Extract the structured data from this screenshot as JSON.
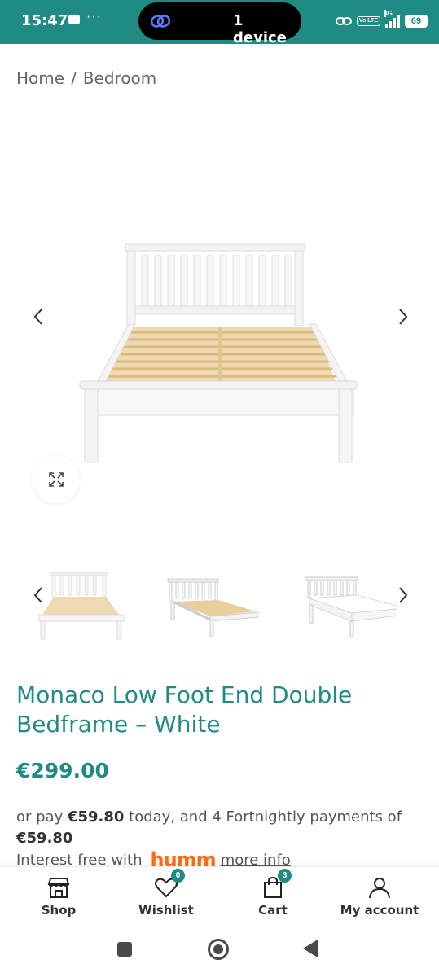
{
  "status_bar": {
    "time": "15:47",
    "dots": "···",
    "pill_label": "1 device",
    "network": "4G",
    "volte": "Vo LTE",
    "battery": "69"
  },
  "breadcrumb": {
    "home": "Home",
    "separator": "/",
    "current": "Bedroom"
  },
  "gallery": {
    "main_image": "bed-frame-white",
    "thumbnails": [
      "bed-frame-white-front",
      "bed-frame-white-angle",
      "bed-frame-white-mattress"
    ]
  },
  "product": {
    "title": "Monaco Low Foot End Double Bedframe – White",
    "price": "€299.00",
    "pay_prefix": "or pay ",
    "pay_amount_today": "€59.80",
    "pay_middle": " today, and 4 Fortnightly payments of ",
    "pay_amount_fortnightly": "€59.80",
    "interest_text": "Interest free with",
    "humm_logo": "humm",
    "more_info": "more info"
  },
  "bottom_nav": {
    "shop": "Shop",
    "wishlist": "Wishlist",
    "wishlist_count": "0",
    "cart": "Cart",
    "cart_count": "3",
    "account": "My account"
  },
  "colors": {
    "accent": "#1f8b83",
    "humm": "#ff6a13"
  }
}
